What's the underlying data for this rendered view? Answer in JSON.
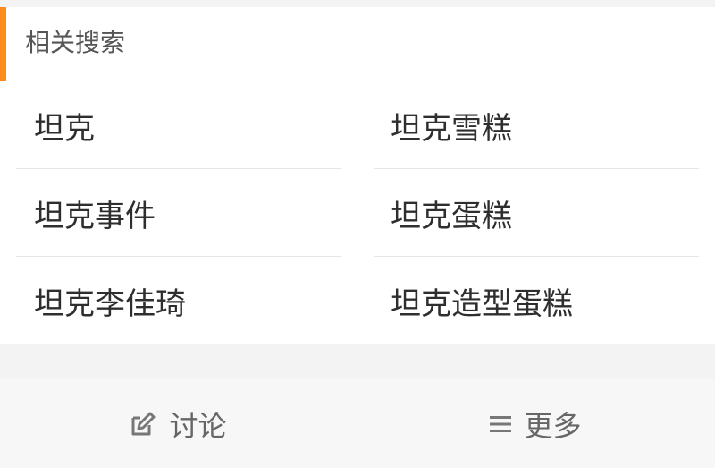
{
  "related_search": {
    "title": "相关搜索",
    "items": [
      {
        "label": "坦克"
      },
      {
        "label": "坦克雪糕"
      },
      {
        "label": "坦克事件"
      },
      {
        "label": "坦克蛋糕"
      },
      {
        "label": "坦克李佳琦"
      },
      {
        "label": "坦克造型蛋糕"
      }
    ]
  },
  "footer": {
    "discuss_label": "讨论",
    "more_label": "更多",
    "discuss_icon": "edit-icon",
    "more_icon": "menu-icon"
  },
  "colors": {
    "accent": "#ff8c1a",
    "background": "#f3f3f3",
    "card": "#ffffff",
    "text": "#2e2e2e",
    "muted": "#666666"
  }
}
